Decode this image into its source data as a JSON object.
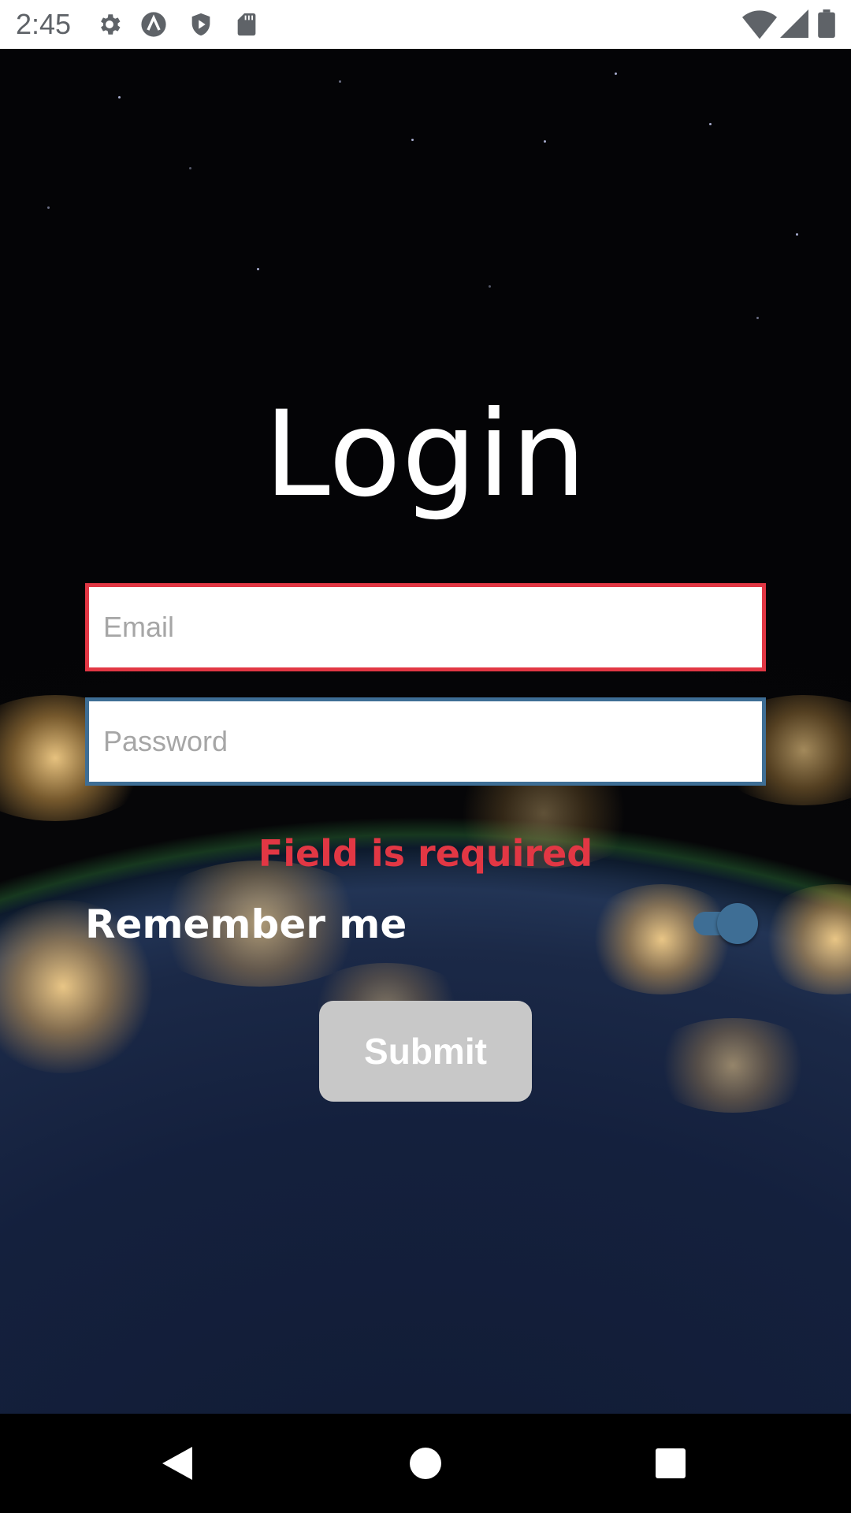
{
  "status_bar": {
    "time": "2:45",
    "icons": [
      "gear-icon",
      "a-circle-icon",
      "shield-play-icon",
      "sd-card-icon",
      "wifi-icon",
      "signal-icon",
      "battery-icon"
    ]
  },
  "login": {
    "title": "Login",
    "email": {
      "placeholder": "Email",
      "value": ""
    },
    "password": {
      "placeholder": "Password",
      "value": ""
    },
    "error": "Field is required",
    "remember_label": "Remember me",
    "remember_on": true,
    "submit_label": "Submit"
  },
  "colors": {
    "error": "#e23744",
    "accent": "#3e6e95",
    "submit_disabled": "#c8c8c8"
  },
  "nav_bar": {
    "icons": [
      "back-icon",
      "home-icon",
      "recents-icon"
    ]
  }
}
